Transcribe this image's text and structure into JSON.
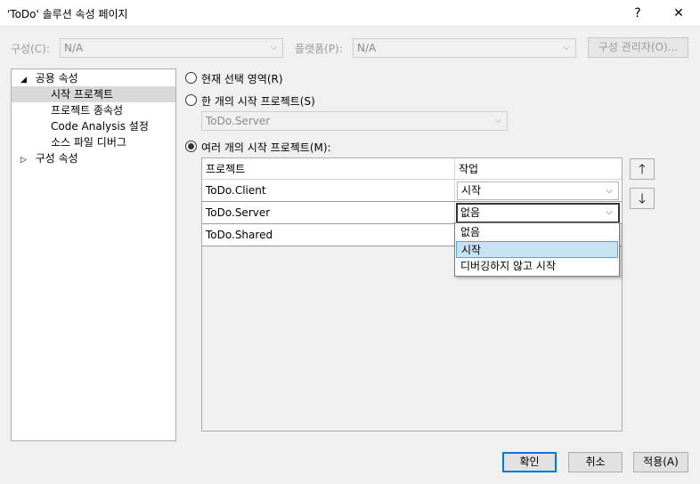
{
  "window": {
    "title": "'ToDo' 솔루션 속성 페이지",
    "help_label": "?",
    "close_label": "✕"
  },
  "config_bar": {
    "configuration_label": "구성(C):",
    "configuration_value": "N/A",
    "platform_label": "플랫폼(P):",
    "platform_value": "N/A",
    "config_manager_label": "구성 관리자(O)..."
  },
  "tree": {
    "common_props": "공용 속성",
    "startup_project": "시작 프로젝트",
    "project_dependencies": "프로젝트 종속성",
    "code_analysis": "Code Analysis 설정",
    "source_files": "소스 파일 디버그",
    "config_props": "구성 속성"
  },
  "options": {
    "current_selection": "현재 선택 영역(R)",
    "single_startup": "한 개의 시작 프로젝트(S)",
    "single_startup_value": "ToDo.Server",
    "multiple_startup": "여러 개의 시작 프로젝트(M):"
  },
  "grid": {
    "col_project": "프로젝트",
    "col_action": "작업",
    "rows": [
      {
        "project": "ToDo.Client",
        "action": "시작"
      },
      {
        "project": "ToDo.Server",
        "action": "없음"
      },
      {
        "project": "ToDo.Shared",
        "action": ""
      }
    ]
  },
  "dropdown": {
    "options": [
      "없음",
      "시작",
      "디버깅하지 않고 시작"
    ],
    "highlighted": "시작"
  },
  "move_buttons": {
    "up": "🡑",
    "down": "🡓"
  },
  "footer": {
    "ok": "확인",
    "cancel": "취소",
    "apply": "적용(A)"
  },
  "colors": {
    "dialog_bg": "#f0f0f0",
    "default_button_border": "#0078d7",
    "dropdown_highlight": "#c7e3f3"
  }
}
